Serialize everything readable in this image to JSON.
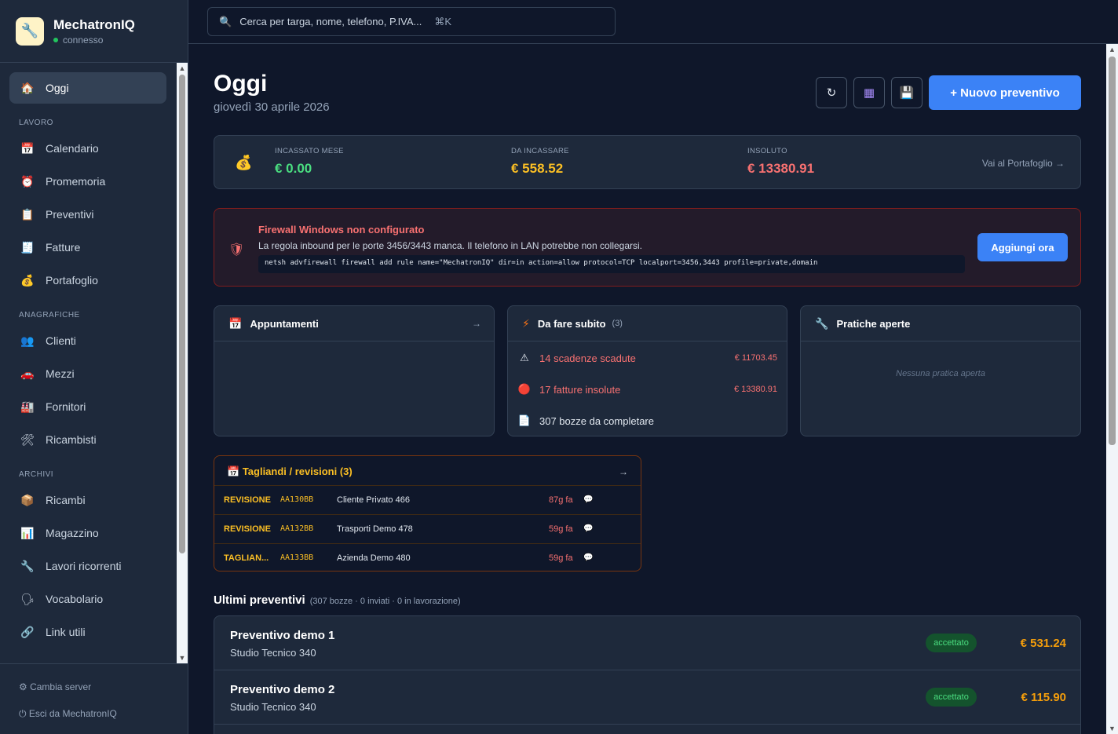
{
  "brand": {
    "name": "MechatronIQ",
    "status": "connesso",
    "logo_icon": "wrench-phone-logo"
  },
  "sidebar": {
    "active": {
      "label": "Oggi",
      "icon": "house-icon"
    },
    "sections": {
      "lavoro": "LAVORO",
      "anagrafiche": "ANAGRAFICHE",
      "archivi": "ARCHIVI"
    },
    "items": [
      {
        "label": "Calendario",
        "icon": "calendar-icon"
      },
      {
        "label": "Promemoria",
        "icon": "alarm-clock-icon"
      },
      {
        "label": "Preventivi",
        "icon": "clipboard-icon"
      },
      {
        "label": "Fatture",
        "icon": "receipt-icon"
      },
      {
        "label": "Portafoglio",
        "icon": "money-bag-icon"
      },
      {
        "label": "Clienti",
        "icon": "people-icon"
      },
      {
        "label": "Mezzi",
        "icon": "car-icon"
      },
      {
        "label": "Fornitori",
        "icon": "factory-icon"
      },
      {
        "label": "Ricambisti",
        "icon": "tools-icon"
      },
      {
        "label": "Ricambi",
        "icon": "package-icon"
      },
      {
        "label": "Magazzino",
        "icon": "bar-chart-icon"
      },
      {
        "label": "Lavori ricorrenti",
        "icon": "wrench-icon"
      },
      {
        "label": "Vocabolario",
        "icon": "speaking-head-icon"
      },
      {
        "label": "Link utili",
        "icon": "link-icon"
      }
    ],
    "footer": {
      "change_server": "⚙ Cambia server",
      "logout": "⏻ Esci da MechatronIQ"
    }
  },
  "search": {
    "placeholder": "Cerca per targa, nome, telefono, P.IVA...",
    "shortcut": "⌘K"
  },
  "page": {
    "title": "Oggi",
    "date": "giovedì 30 aprile 2026",
    "new_quote": "+ Nuovo preventivo"
  },
  "toolbar": {
    "refresh": "↻",
    "calculator": "▦",
    "save": "💾"
  },
  "stats": {
    "incassato_label": "INCASSATO MESE",
    "incassato_value": "€ 0.00",
    "da_incassare_label": "DA INCASSARE",
    "da_incassare_value": "€ 558.52",
    "insoluto_label": "INSOLUTO",
    "insoluto_value": "€ 13380.91",
    "link": "Vai al Portafoglio →"
  },
  "alert": {
    "title": "Firewall Windows non configurato",
    "description": "La regola inbound per le porte 3456/3443 manca. Il telefono in LAN potrebbe non collegarsi.",
    "command": "netsh advfirewall firewall add rule name=\"MechatronIQ\" dir=in action=allow protocol=TCP localport=3456,3443 profile=private,domain",
    "button": "Aggiungi ora"
  },
  "appointments": {
    "title": "Appuntamenti",
    "arrow": "→"
  },
  "todo": {
    "title": "Da fare subito",
    "count": "(3)",
    "items": [
      {
        "label": "14 scadenze scadute",
        "amount": "€ 11703.45",
        "icon": "warning-icon"
      },
      {
        "label": "17 fatture insolute",
        "amount": "€ 13380.91",
        "icon": "red-circle-icon"
      },
      {
        "label": "307 bozze da completare",
        "icon": "document-icon"
      }
    ]
  },
  "open_practices": {
    "title": "Pratiche aperte",
    "empty": "Nessuna pratica aperta"
  },
  "tagliandi": {
    "title": "Tagliandi / revisioni (3)",
    "arrow": "→",
    "rows": [
      {
        "kind": "REVISIONE",
        "plate": "AA130BB",
        "client": "Cliente Privato 466",
        "ago": "87g fa"
      },
      {
        "kind": "REVISIONE",
        "plate": "AA132BB",
        "client": "Trasporti Demo 478",
        "ago": "59g fa"
      },
      {
        "kind": "TAGLIAN...",
        "plate": "AA133BB",
        "client": "Azienda Demo 480",
        "ago": "59g fa"
      }
    ]
  },
  "quotes": {
    "title": "Ultimi preventivi",
    "meta": "(307 bozze · 0 inviati · 0 in lavorazione)",
    "rows": [
      {
        "title": "Preventivo demo 1",
        "client": "Studio Tecnico 340",
        "status": "accettato",
        "amount": "€ 531.24"
      },
      {
        "title": "Preventivo demo 2",
        "client": "Studio Tecnico 340",
        "status": "accettato",
        "amount": "€ 115.90"
      }
    ]
  },
  "colors": {
    "accent": "#3b82f6",
    "green": "#4ade80",
    "amber": "#f59e0b",
    "red": "#f87171"
  }
}
